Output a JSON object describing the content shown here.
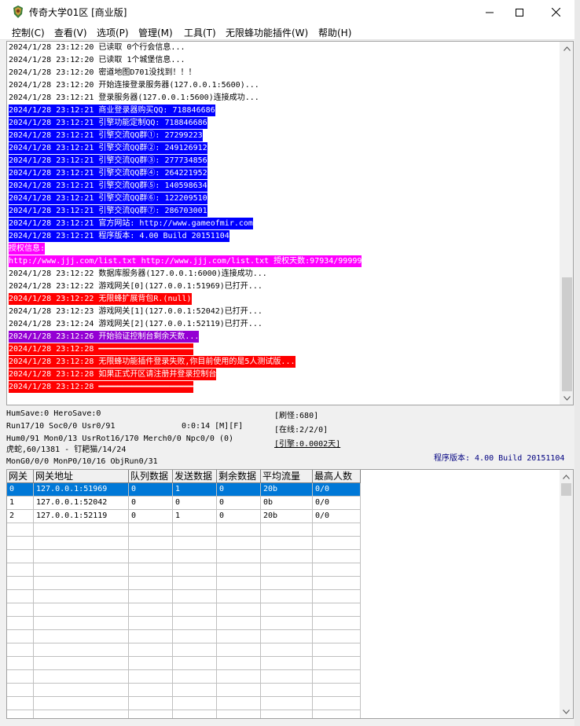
{
  "window": {
    "title": "传奇大学01区 [商业版]",
    "icon": "legend-server-app-icon",
    "controls": [
      "minimize",
      "maximize",
      "close"
    ]
  },
  "menu": [
    {
      "label": "控制(C)"
    },
    {
      "label": "查看(V)"
    },
    {
      "label": "选项(P)"
    },
    {
      "label": "管理(M)"
    },
    {
      "label": "工具(T)"
    },
    {
      "label": "无限蜂功能插件(W)"
    },
    {
      "label": "帮助(H)"
    }
  ],
  "log": [
    {
      "text": "2024/1/28 23:12:20 已读取 0个行会信息...",
      "style": "normal"
    },
    {
      "text": "2024/1/28 23:12:20 已读取 1个城堡信息...",
      "style": "normal"
    },
    {
      "text": "2024/1/28 23:12:20 密道地图D701没找到！！！",
      "style": "normal"
    },
    {
      "text": "2024/1/28 23:12:20 开始连接登录服务器(127.0.0.1:5600)...",
      "style": "normal"
    },
    {
      "text": "2024/1/28 23:12:21 登录服务器(127.0.0.1:5600)连接成功...",
      "style": "normal"
    },
    {
      "text": "2024/1/28 23:12:21 商业登录器购买QQ: 718846686",
      "style": "blue"
    },
    {
      "text": "2024/1/28 23:12:21 引擎功能定制QQ: 718846686",
      "style": "blue"
    },
    {
      "text": "2024/1/28 23:12:21 引擎交流QQ群①: 27299223",
      "style": "blue"
    },
    {
      "text": "2024/1/28 23:12:21 引擎交流QQ群②: 249126912",
      "style": "blue"
    },
    {
      "text": "2024/1/28 23:12:21 引擎交流QQ群③: 277734856",
      "style": "blue"
    },
    {
      "text": "2024/1/28 23:12:21 引擎交流QQ群④: 264221952",
      "style": "blue"
    },
    {
      "text": "2024/1/28 23:12:21 引擎交流QQ群⑤: 140598634",
      "style": "blue"
    },
    {
      "text": "2024/1/28 23:12:21 引擎交流QQ群⑥: 122209510",
      "style": "blue"
    },
    {
      "text": "2024/1/28 23:12:21 引擎交流QQ群⑦: 286703001",
      "style": "blue"
    },
    {
      "text": "2024/1/28 23:12:21 官方网站: http://www.gameofmir.com",
      "style": "blue"
    },
    {
      "text": "2024/1/28 23:12:21 程序版本: 4.00 Build 20151104",
      "style": "blue"
    },
    {
      "text": "授权信息:",
      "style": "magenta"
    },
    {
      "text": "http://www.jjj.com/list.txt http://www.jjj.com/list.txt 授权天数:97934/99999",
      "style": "magenta"
    },
    {
      "text": "2024/1/28 23:12:22 数据库服务器(127.0.0.1:6000)连接成功...",
      "style": "normal"
    },
    {
      "text": "2024/1/28 23:12:22 游戏网关[0](127.0.0.1:51969)已打开...",
      "style": "normal"
    },
    {
      "text": "2024/1/28 23:12:22 无限蜂扩展背包R.(null)",
      "style": "red"
    },
    {
      "text": "2024/1/28 23:12:23 游戏网关[1](127.0.0.1:52042)已打开...",
      "style": "normal"
    },
    {
      "text": "2024/1/28 23:12:24 游戏网关[2](127.0.0.1:52119)已打开...",
      "style": "normal"
    },
    {
      "text": "2024/1/28 23:12:26 开始验证控制台剩余天数...",
      "style": "purple"
    },
    {
      "text": "2024/1/28 23:12:28 ━━━━━━━━━━━━━━━━━━━━",
      "style": "red"
    },
    {
      "text": "2024/1/28 23:12:28 无限蜂功能插件登录失败,你目前使用的是5人测试版...",
      "style": "red"
    },
    {
      "text": "2024/1/28 23:12:28 如果正式开区请注册并登录控制台",
      "style": "red"
    },
    {
      "text": "2024/1/28 23:12:28 ━━━━━━━━━━━━━━━━━━━━",
      "style": "red"
    }
  ],
  "status": {
    "line1": "HumSave:0 HeroSave:0",
    "line2": "Run17/10 Soc0/0 Usr0/91",
    "timer": "0:0:14 [M][F]",
    "line3": "Hum0/91 Mon0/13 UsrRot16/170 Merch0/0 Npc0/0 (0)",
    "line4": "虎蛇,60/1381 - 钉耙猫/14/24",
    "line5": "MonG0/0/0 MonP0/10/16 ObjRun0/31",
    "refresh": "[刷怪:680]",
    "online": "[在线:2/2/0]",
    "engine": "[引擎:0.0002天]",
    "version": "程序版本: 4.00 Build 20151104"
  },
  "gateway_table": {
    "columns": [
      "网关",
      "网关地址",
      "队列数据",
      "发送数据",
      "剩余数据",
      "平均流量",
      "最高人数"
    ],
    "rows": [
      [
        "0",
        "127.0.0.1:51969",
        "0",
        "1",
        "0",
        "20b",
        "0/0"
      ],
      [
        "1",
        "127.0.0.1:52042",
        "0",
        "0",
        "0",
        "0b",
        "0/0"
      ],
      [
        "2",
        "127.0.0.1:52119",
        "0",
        "1",
        "0",
        "20b",
        "0/0"
      ]
    ],
    "selected_row": 0
  },
  "colors": {
    "highlight_blue": "#0000ff",
    "highlight_magenta": "#ff00ff",
    "highlight_red": "#ff0000",
    "highlight_purple": "#9400d3",
    "selection": "#0078d7"
  }
}
